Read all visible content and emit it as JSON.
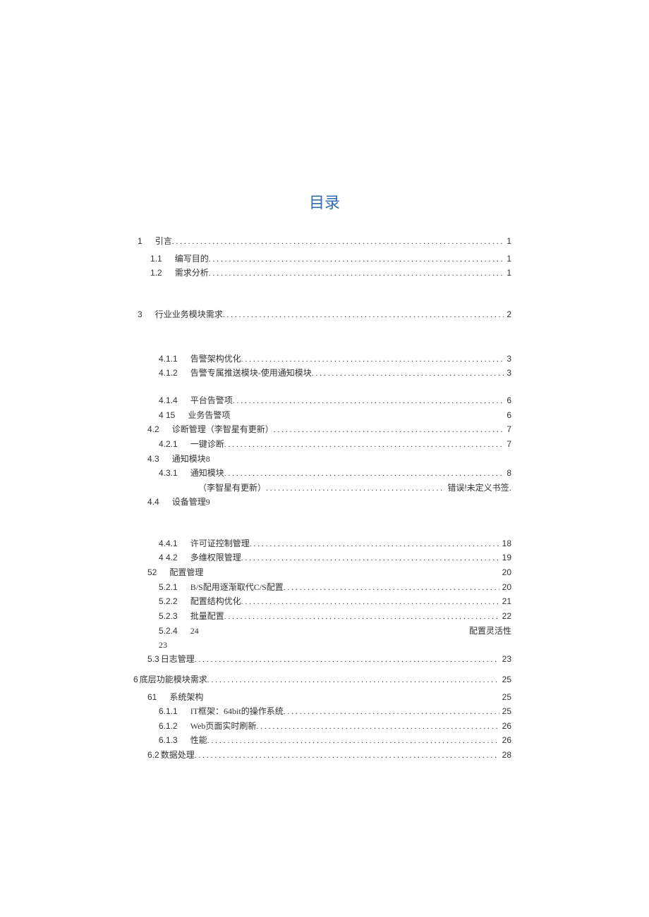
{
  "title": "目录",
  "entries": [
    {
      "level": 1,
      "num": "1",
      "label": "引言",
      "page": "1",
      "dots": true
    },
    {
      "level": 2,
      "num": "1.1",
      "label": "编写目的",
      "page": "1",
      "dots": true
    },
    {
      "level": 2,
      "num": "1.2",
      "label": "需求分析",
      "page": "1",
      "dots": true
    },
    {
      "level": 0,
      "gap": "lg"
    },
    {
      "level": 1,
      "num": "3",
      "label": "行业业务模块需求",
      "page": "2",
      "dots": true
    },
    {
      "level": 0,
      "gap": "xl"
    },
    {
      "level": 3,
      "num": "4.1.1",
      "label": "告警架构优化",
      "page": "3",
      "dots": true
    },
    {
      "level": 3,
      "num": "4.1.2",
      "label": "告警专属推送模块-使用通知模块",
      "page": "3",
      "dots": true
    },
    {
      "level": 0,
      "gap": "md"
    },
    {
      "level": 3,
      "num": "4.1.4",
      "label": "平台告警项",
      "page": "6",
      "dots": true
    },
    {
      "level": 3,
      "num": "4 15",
      "label": "业务告警项",
      "page": "6",
      "dots": false
    },
    {
      "level": 2,
      "num": "4.2",
      "label": "诊断管理（李智星有更新）",
      "page": "7",
      "dots": true,
      "lvlClass": "lvlx"
    },
    {
      "level": 3,
      "num": "4.2.1",
      "label": "一键诊断",
      "page": "7",
      "dots": true
    },
    {
      "level": 2,
      "num": "4.3",
      "label": "通知模块8",
      "page": "",
      "dots": false,
      "lvlClass": "lvlx"
    },
    {
      "level": 3,
      "num": "4.3.1",
      "label": "通知模块",
      "page": "8",
      "dots": true
    },
    {
      "level": 3,
      "num": "",
      "label": "（李智星有更新）",
      "page": "错误!未定义书签.",
      "dots": true,
      "indentInner": true
    },
    {
      "level": 2,
      "num": "4.4",
      "label": "设备管理9",
      "page": "",
      "dots": false,
      "lvlClass": "lvlx"
    },
    {
      "level": 0,
      "gap": "xl"
    },
    {
      "level": 3,
      "num": "4.4.1",
      "label": "许可证控制管理",
      "page": "18",
      "dots": true
    },
    {
      "level": 3,
      "num": "4 4.2",
      "label": "多维权限管理",
      "page": "19",
      "dots": true
    },
    {
      "level": 2,
      "num": "52",
      "label": "配置管理",
      "page": "20",
      "dots": false,
      "lvlClass": "lvlx"
    },
    {
      "level": 3,
      "num": "5.2.1",
      "label": "B/S配用逐渐取代C/S配置",
      "page": "20",
      "dots": true
    },
    {
      "level": 3,
      "num": "5.2.2",
      "label": "配置结构优化",
      "page": "21",
      "dots": true
    },
    {
      "level": 3,
      "num": "5.2.3",
      "label": "批量配置",
      "page": "22",
      "dots": true
    },
    {
      "level": 3,
      "num": "5.2.4",
      "label": "24",
      "page": "配置灵活性",
      "dots": false
    },
    {
      "level": 3,
      "num": "",
      "label": "23",
      "page": "",
      "dots": false
    },
    {
      "level": 2,
      "num": "5.3",
      "label": "日志管理",
      "page": "23",
      "dots": true,
      "lvlClass": "lvlx",
      "tight": true
    },
    {
      "level": 1,
      "num": "6",
      "label": "底层功能模块需求",
      "page": "25",
      "dots": true,
      "tight": true,
      "noindent": true
    },
    {
      "level": 0,
      "gap": "sm"
    },
    {
      "level": 2,
      "num": "61",
      "label": "系统架构",
      "page": "25",
      "dots": false,
      "lvlClass": "lvlx"
    },
    {
      "level": 3,
      "num": "6.1.1",
      "label": "IT框架：64bit的操作系统",
      "page": "25",
      "dots": true
    },
    {
      "level": 3,
      "num": "6.1.2",
      "label": "Web页面实时刷新",
      "page": "26",
      "dots": true
    },
    {
      "level": 3,
      "num": "6.1.3",
      "label": "性能",
      "page": "26",
      "dots": true
    },
    {
      "level": 2,
      "num": "6.2",
      "label": "数据处理",
      "page": "28",
      "dots": true,
      "lvlClass": "lvlx",
      "tight": true
    }
  ]
}
